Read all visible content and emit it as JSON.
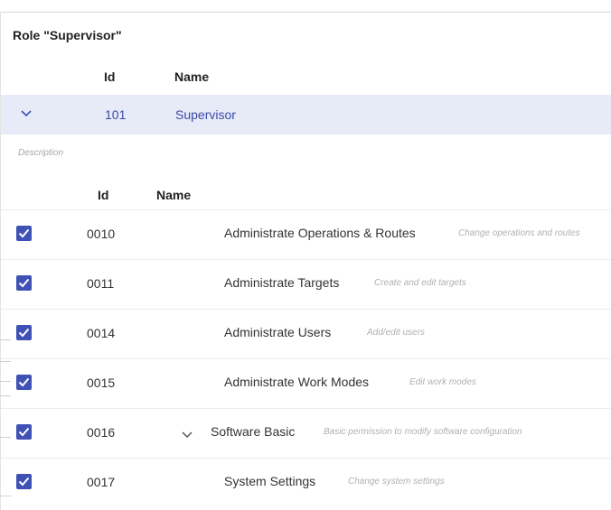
{
  "role": {
    "title": "Role \"Supervisor\"",
    "columns": {
      "id": "Id",
      "name": "Name"
    },
    "row": {
      "id": "101",
      "name": "Supervisor",
      "expanded": true
    }
  },
  "description_label": "Description",
  "permissions": {
    "columns": {
      "id": "Id",
      "name": "Name"
    },
    "rows": [
      {
        "checked": true,
        "id": "0010",
        "name": "Administrate Operations & Routes",
        "desc": "Change operations and routes"
      },
      {
        "checked": true,
        "id": "0011",
        "name": "Administrate Targets",
        "desc": "Create and edit targets"
      },
      {
        "checked": true,
        "id": "0014",
        "name": "Administrate Users",
        "desc": "Add/edit users"
      },
      {
        "checked": true,
        "id": "0015",
        "name": "Administrate Work Modes",
        "desc": "Edit work modes"
      },
      {
        "checked": true,
        "id": "0016",
        "name": "Software Basic",
        "desc": "Basic permission to modify software configuration",
        "expanded": true
      },
      {
        "checked": true,
        "id": "0017",
        "name": "System Settings",
        "desc": "Change system settings"
      }
    ]
  },
  "colors": {
    "accent": "#3f51b5",
    "selected_row_bg": "#e7eaf7",
    "link_text": "#3a4ba7"
  }
}
